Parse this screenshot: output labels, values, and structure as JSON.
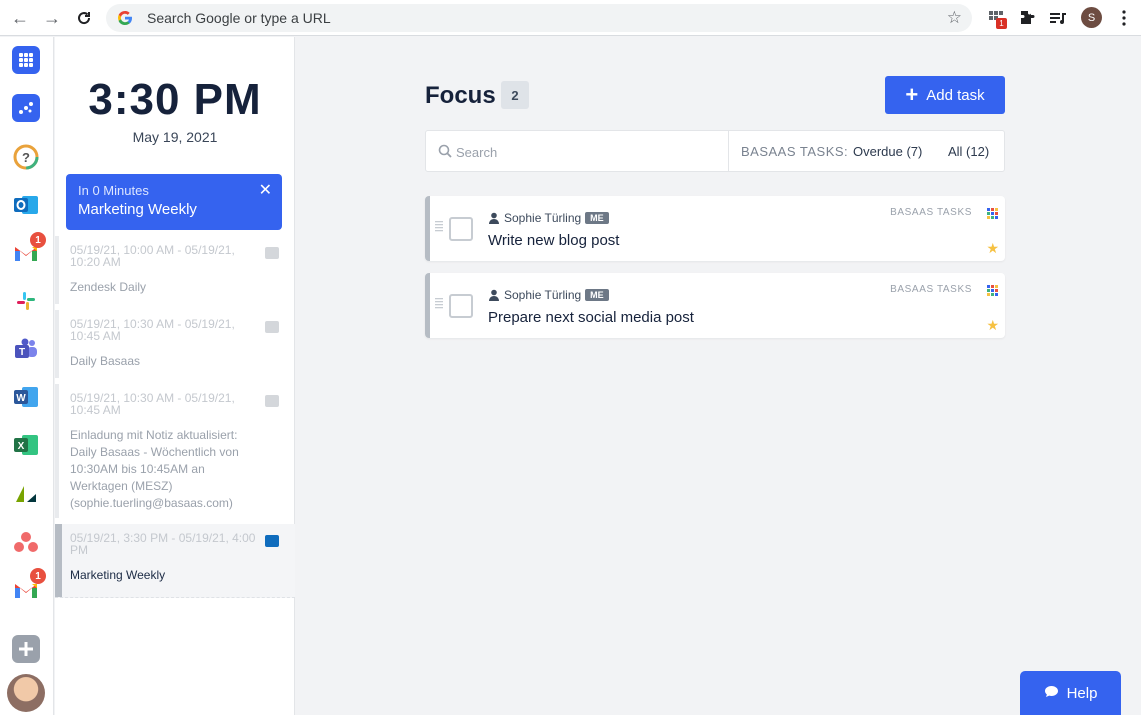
{
  "browser": {
    "address_placeholder": "Search Google or type a URL",
    "extension_badge": "1",
    "profile_initial": "S",
    "icons": [
      "back-icon",
      "forward-icon",
      "reload-icon",
      "google-icon",
      "bookmark-star-icon",
      "extension-grid-icon",
      "puzzle-icon",
      "media-queue-icon",
      "kebab-menu-icon"
    ]
  },
  "rail": {
    "apps": [
      {
        "name": "apps-grid",
        "color": "#3563ef"
      },
      {
        "name": "basaas",
        "color": "#3563ef"
      },
      {
        "name": "help-circle",
        "color": "#e9a23b"
      },
      {
        "name": "outlook",
        "color": "#0f6cbd"
      },
      {
        "name": "gmail",
        "color": "#ea4335",
        "badge": "1"
      },
      {
        "name": "slack",
        "color": "#e01e5a"
      },
      {
        "name": "teams",
        "color": "#5059c9"
      },
      {
        "name": "word",
        "color": "#2b579a"
      },
      {
        "name": "excel",
        "color": "#217346"
      },
      {
        "name": "zendesk",
        "color": "#03363d"
      },
      {
        "name": "asana",
        "color": "#f06a6a"
      },
      {
        "name": "gmail-2",
        "color": "#ea4335",
        "badge": "1"
      },
      {
        "name": "add-app",
        "color": "#9aa1ab"
      }
    ]
  },
  "agenda": {
    "time": "3:30 PM",
    "date": "May 19, 2021",
    "next": {
      "subtitle": "In 0 Minutes",
      "title": "Marketing Weekly"
    },
    "events": [
      {
        "time": "05/19/21, 10:00 AM - 05/19/21, 10:20 AM",
        "title": "Zendesk Daily",
        "source": "calendar"
      },
      {
        "time": "05/19/21, 10:30 AM - 05/19/21, 10:45 AM",
        "title": "Daily Basaas",
        "source": "calendar"
      },
      {
        "time": "05/19/21, 10:30 AM - 05/19/21, 10:45 AM",
        "title": "Einladung mit Notiz aktualisiert: Daily Basaas - Wöchentlich von 10:30AM bis 10:45AM an Werktagen (MESZ) (sophie.tuerling@basaas.com)",
        "source": "calendar"
      },
      {
        "time": "05/19/21, 3:30 PM - 05/19/21, 4:00 PM",
        "title": "Marketing Weekly",
        "source": "outlook"
      }
    ]
  },
  "main": {
    "title": "Focus",
    "count": "2",
    "add_task": "Add task",
    "search_placeholder": "Search",
    "filter_label": "BASAAS TASKS:",
    "filters": [
      "Overdue (7)",
      "All (12)"
    ],
    "tasks": [
      {
        "assignee": "Sophie Türling",
        "badge": "ME",
        "title": "Write new blog post",
        "source": "BASAAS TASKS",
        "starred": true
      },
      {
        "assignee": "Sophie Türling",
        "badge": "ME",
        "title": "Prepare next social media post",
        "source": "BASAAS TASKS",
        "starred": true
      }
    ]
  },
  "help": {
    "label": "Help"
  },
  "colors": {
    "accent": "#3563ef",
    "title": "#16223b",
    "star": "#f6c142",
    "badge": "#e8503f"
  }
}
